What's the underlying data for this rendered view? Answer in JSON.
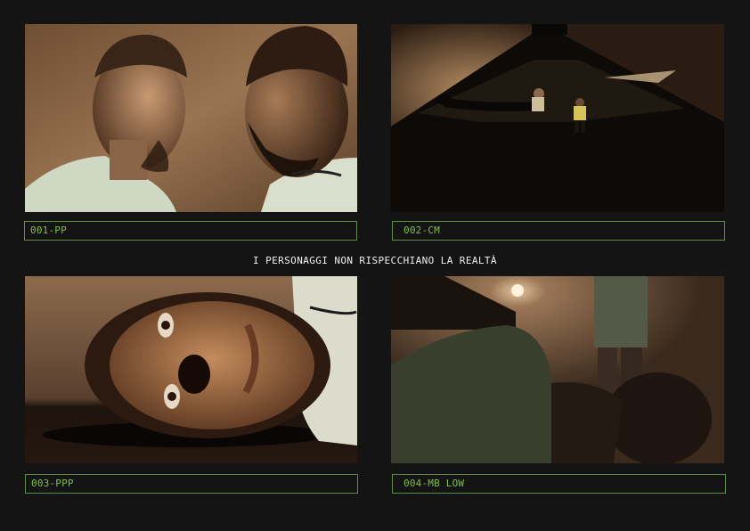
{
  "caption": "I PERSONAGGI NON RISPECCHIANO LA REALTÀ",
  "shots": [
    {
      "label": "001-PP"
    },
    {
      "label": "002-CM"
    },
    {
      "label": "003-PPP"
    },
    {
      "label": "004-MB LOW"
    }
  ],
  "colors": {
    "background": "#141414",
    "label_border": "#5f8f3f",
    "label_text": "#7fbf4a",
    "caption_text": "#f0f0f0"
  }
}
